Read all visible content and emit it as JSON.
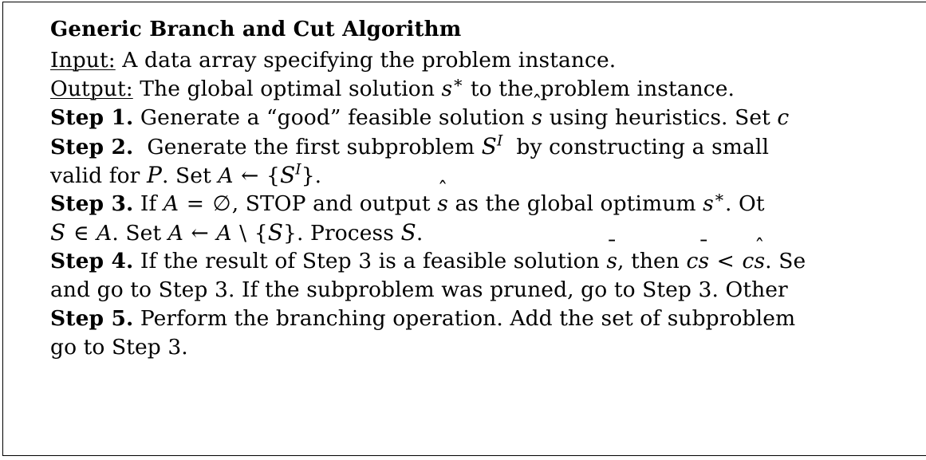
{
  "algorithm": {
    "title": "Generic Branch and Cut Algorithm",
    "input_label": "Input:",
    "input_text": "A data array specifying the problem instance.",
    "output_label": "Output:",
    "output_text_before": "The global optimal solution",
    "output_math": "s*",
    "output_text_after": "to the problem instance.",
    "steps": [
      {
        "label": "Step 1.",
        "lines": [
          "Generate a “good” feasible solution ŝ using heuristics. Set c"
        ]
      },
      {
        "label": "Step 2.",
        "lines": [
          "Generate the first subproblem 𝒮I by constructing a small",
          "valid for 𝒫. Set A ← {𝒮I}."
        ]
      },
      {
        "label": "Step 3.",
        "lines": [
          "If A = ∅, STOP and output ŝ as the global optimum s*. Ot",
          "𝒮 ∈ A. Set A ← A \\ {𝒮}. Process 𝒮."
        ]
      },
      {
        "label": "Step 4.",
        "lines": [
          "If the result of Step 3 is a feasible solution s̄, then cs̄ < cŝ. Se",
          "and go to Step 3. If the subproblem was pruned, go to Step 3. Other"
        ]
      },
      {
        "label": "Step 5.",
        "lines": [
          "Perform the branching operation. Add the set of subproblem",
          "go to Step 3."
        ]
      }
    ],
    "fragments": {
      "s1_a": "Generate a “good” feasible solution",
      "s1_shat": "s",
      "s1_b": "using heuristics. Set",
      "s1_c": "c",
      "s2_a": "Generate the first subproblem",
      "s2_S": "S",
      "s2_supI": "I",
      "s2_b": "by constructing a small",
      "s2_c": "valid for",
      "s2_P": "P",
      "s2_d": ". Set",
      "s2_A": "A",
      "s2_arrow": "←",
      "s2_brace_open": "{",
      "s2_brace_close": "}.",
      "s3_if": "If",
      "s3_A": "A",
      "s3_eq": "=",
      "s3_empty": "∅",
      "s3_a": ", STOP and output",
      "s3_shat": "s",
      "s3_b": "as the global optimum",
      "s3_s": "s",
      "s3_c": ". Ot",
      "s3_S": "S",
      "s3_in": "∈",
      "s3_d": ". Set",
      "s3_e": "←",
      "s3_setminus": "\\",
      "s3_f": ". Process",
      "s3_g": ".",
      "s4_a": "If the result of Step 3 is a feasible solution",
      "s4_sbar": "s",
      "s4_b": ", then",
      "s4_csbar_c": "c",
      "s4_csbar_s": "s",
      "s4_lt": "<",
      "s4_cshat_c": "c",
      "s4_cshat_s": "s",
      "s4_c": ". Se",
      "s4_d": "and go to Step 3. If the subproblem was pruned, go to Step 3. Other",
      "s5_a": "Perform the branching operation. Add the set of subproblem",
      "s5_b": "go to Step 3."
    },
    "colors": {
      "text": "#000000",
      "background": "#ffffff",
      "border": "#000000"
    }
  }
}
